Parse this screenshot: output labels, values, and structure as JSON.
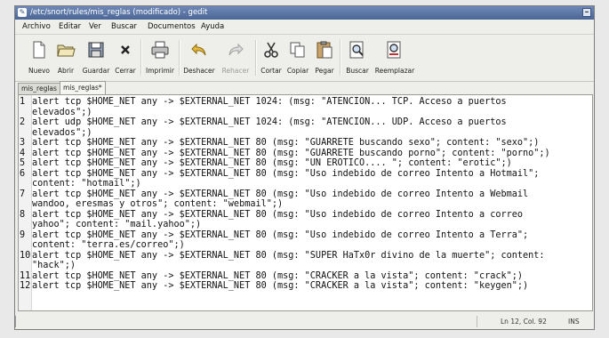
{
  "window": {
    "title": "/etc/snort/rules/mis_reglas (modificado) - gedit",
    "title_icon": "✎",
    "minimize_glyph": "–"
  },
  "menubar": {
    "items": [
      "Archivo",
      "Editar",
      "Ver",
      "Buscar",
      "Documentos",
      "Ayuda"
    ]
  },
  "toolbar": {
    "buttons": [
      {
        "label": "Nuevo",
        "icon": "new-document-icon"
      },
      {
        "label": "Abrir",
        "icon": "open-folder-icon"
      },
      {
        "label": "Guardar",
        "icon": "save-icon"
      },
      {
        "label": "Cerrar",
        "icon": "close-icon"
      },
      {
        "label": "Imprimir",
        "icon": "print-icon"
      },
      {
        "label": "Deshacer",
        "icon": "undo-icon"
      },
      {
        "label": "Rehacer",
        "icon": "redo-icon",
        "disabled": true
      },
      {
        "label": "Cortar",
        "icon": "cut-icon"
      },
      {
        "label": "Copiar",
        "icon": "copy-icon"
      },
      {
        "label": "Pegar",
        "icon": "paste-icon"
      },
      {
        "label": "Buscar",
        "icon": "find-icon"
      },
      {
        "label": "Reemplazar",
        "icon": "replace-icon"
      }
    ]
  },
  "tabs": [
    {
      "label": "mis_reglas",
      "active": false
    },
    {
      "label": "mis_reglas*",
      "active": true
    }
  ],
  "editor": {
    "lines": [
      {
        "n": "1",
        "text": "alert tcp $HOME_NET any -> $EXTERNAL_NET 1024: (msg: \"ATENCION... TCP. Acceso a puertos\nelevados\";)"
      },
      {
        "n": "2",
        "text": "alert udp $HOME_NET any -> $EXTERNAL_NET 1024: (msg: \"ATENCION... UDP. Acceso a puertos\nelevados\";)"
      },
      {
        "n": "3",
        "text": "alert tcp $HOME_NET any -> $EXTERNAL_NET 80 (msg: \"GUARRETE buscando sexo\"; content: \"sexo\";)"
      },
      {
        "n": "4",
        "text": "alert tcp $HOME_NET any -> $EXTERNAL_NET 80 (msg: \"GUARRETE buscando porno\"; content: \"porno\";)"
      },
      {
        "n": "5",
        "text": "alert tcp $HOME_NET any -> $EXTERNAL_NET 80 (msg: \"UN EROTICO.... \"; content: \"erotic\";)"
      },
      {
        "n": "6",
        "text": "alert tcp $HOME_NET any -> $EXTERNAL_NET 80 (msg: \"Uso indebido de correo Intento a Hotmail\";\ncontent: \"hotmail\";)"
      },
      {
        "n": "7",
        "text": "alert tcp $HOME_NET any -> $EXTERNAL_NET 80 (msg: \"Uso indebido de correo Intento a Webmail\nwandoo, eresmas y otros\"; content: \"webmail\";)"
      },
      {
        "n": "8",
        "text": "alert tcp $HOME_NET any -> $EXTERNAL_NET 80 (msg: \"Uso indebido de correo Intento a correo\nyahoo\"; content: \"mail.yahoo\";)"
      },
      {
        "n": "9",
        "text": "alert tcp $HOME_NET any -> $EXTERNAL_NET 80 (msg: \"Uso indebido de correo Intento a Terra\";\ncontent: \"terra.es/correo\";)"
      },
      {
        "n": "10",
        "text": "alert tcp $HOME_NET any -> $EXTERNAL_NET 80 (msg: \"SUPER HaTx0r divino de la muerte\"; content:\n\"hack\";)"
      },
      {
        "n": "11",
        "text": "alert tcp $HOME_NET any -> $EXTERNAL_NET 80 (msg: \"CRACKER a la vista\"; content: \"crack\";)"
      },
      {
        "n": "12",
        "text": "alert tcp $HOME_NET any -> $EXTERNAL_NET 80 (msg: \"CRACKER a la vista\"; content: \"keygen\";)"
      }
    ]
  },
  "statusbar": {
    "position": "Ln 12, Col. 92",
    "mode": "INS"
  }
}
